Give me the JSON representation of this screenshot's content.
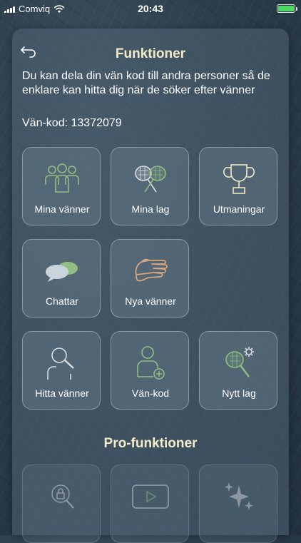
{
  "status": {
    "carrier": "Comviq",
    "time": "20:43",
    "battery_level": 1.0
  },
  "header": {
    "title": "Funktioner"
  },
  "info": {
    "description": "Du kan dela din vän kod till andra personer så de enklare kan hitta dig när de söker efter vänner",
    "code": "Vän-kod: 13372079"
  },
  "tiles": [
    {
      "label": "Mina vänner",
      "icon": "friends-group-icon"
    },
    {
      "label": "Mina lag",
      "icon": "tennis-rackets-icon"
    },
    {
      "label": "Utmaningar",
      "icon": "trophy-icon"
    },
    {
      "label": "Chattar",
      "icon": "chat-bubbles-icon"
    },
    {
      "label": "Nya vänner",
      "icon": "wave-hand-icon"
    },
    {
      "label": "Hitta vänner",
      "icon": "search-person-icon"
    },
    {
      "label": "Vän-kod",
      "icon": "add-person-icon"
    },
    {
      "label": "Nytt lag",
      "icon": "racket-settings-icon"
    }
  ],
  "pro": {
    "title": "Pro-funktioner",
    "tiles": [
      {
        "icon": "search-lock-icon"
      },
      {
        "icon": "video-play-icon"
      },
      {
        "icon": "sparkles-icon"
      }
    ]
  },
  "colors": {
    "accent_green": "#8fbf82",
    "icon_orange": "#d9a57a",
    "title_cream": "#f3ebc7"
  }
}
